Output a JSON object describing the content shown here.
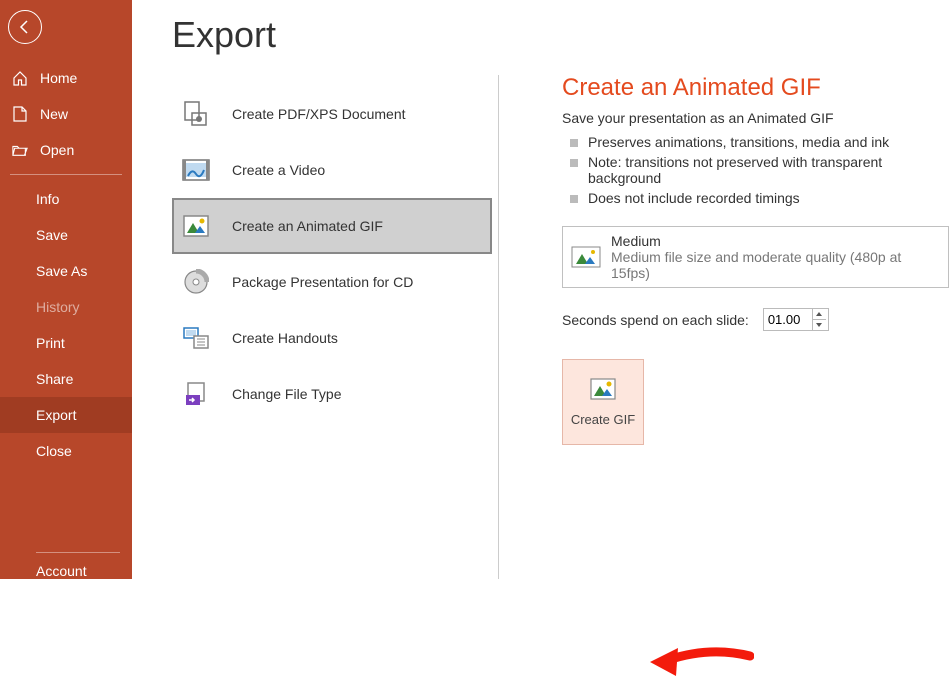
{
  "sidebar": {
    "home": "Home",
    "new": "New",
    "open": "Open",
    "info": "Info",
    "save": "Save",
    "saveas": "Save As",
    "history": "History",
    "print": "Print",
    "share": "Share",
    "export": "Export",
    "close": "Close",
    "account": "Account"
  },
  "page_title": "Export",
  "options": {
    "pdf": "Create PDF/XPS Document",
    "video": "Create a Video",
    "gif": "Create an Animated GIF",
    "cd": "Package Presentation for CD",
    "hand": "Create Handouts",
    "change": "Change File Type"
  },
  "panel": {
    "title": "Create an Animated GIF",
    "subtitle": "Save your presentation as an Animated GIF",
    "bullets": [
      "Preserves animations, transitions, media and ink",
      "Note: transitions not preserved with transparent background",
      "Does not include recorded timings"
    ],
    "quality": {
      "name": "Medium",
      "desc": "Medium file size and moderate quality (480p at 15fps)"
    },
    "seconds_label": "Seconds spend on each slide:",
    "seconds_value": "01.00",
    "create_label": "Create GIF"
  },
  "colors": {
    "accent": "#B7472A",
    "heading": "#E44A1E"
  }
}
